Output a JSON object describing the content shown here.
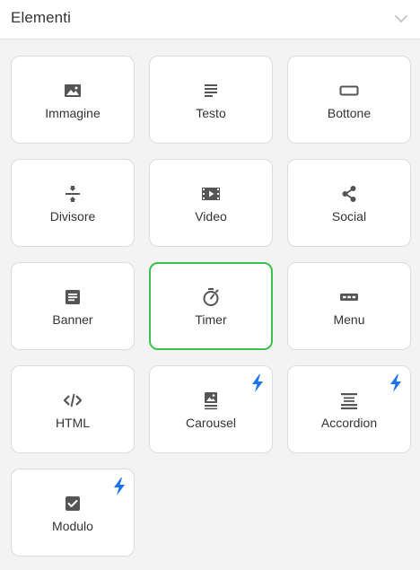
{
  "panel": {
    "title": "Elementi",
    "collapse_icon": "chevron-down-icon"
  },
  "colors": {
    "icon": "#555555",
    "label": "#333333",
    "selected_border": "#3cc24a",
    "premium_bolt": "#1a73e8"
  },
  "elements": [
    {
      "label": "Immagine",
      "icon": "image-icon",
      "premium": false,
      "selected": false
    },
    {
      "label": "Testo",
      "icon": "text-icon",
      "premium": false,
      "selected": false
    },
    {
      "label": "Bottone",
      "icon": "button-icon",
      "premium": false,
      "selected": false
    },
    {
      "label": "Divisore",
      "icon": "divider-icon",
      "premium": false,
      "selected": false
    },
    {
      "label": "Video",
      "icon": "video-icon",
      "premium": false,
      "selected": false
    },
    {
      "label": "Social",
      "icon": "share-icon",
      "premium": false,
      "selected": false
    },
    {
      "label": "Banner",
      "icon": "banner-icon",
      "premium": false,
      "selected": false
    },
    {
      "label": "Timer",
      "icon": "timer-icon",
      "premium": false,
      "selected": true
    },
    {
      "label": "Menu",
      "icon": "menu-icon",
      "premium": false,
      "selected": false
    },
    {
      "label": "HTML",
      "icon": "code-icon",
      "premium": false,
      "selected": false
    },
    {
      "label": "Carousel",
      "icon": "carousel-icon",
      "premium": true,
      "selected": false
    },
    {
      "label": "Accordion",
      "icon": "accordion-icon",
      "premium": true,
      "selected": false
    },
    {
      "label": "Modulo",
      "icon": "form-checkbox-icon",
      "premium": true,
      "selected": false
    }
  ]
}
